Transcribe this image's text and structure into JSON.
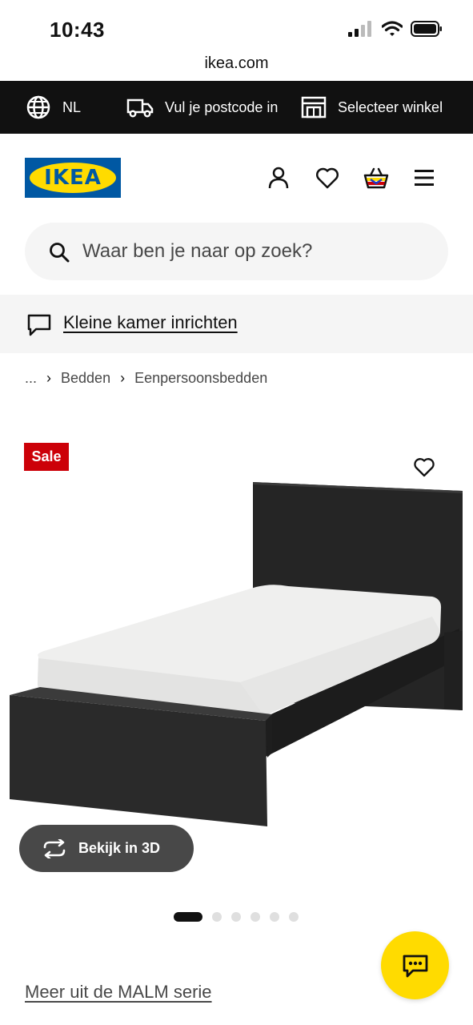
{
  "status_bar": {
    "time": "10:43"
  },
  "browser": {
    "url": "ikea.com"
  },
  "topbar": {
    "language": "NL",
    "postcode": "Vul je postcode in",
    "store": "Selecteer winkel"
  },
  "header": {
    "logo_text": "IKEA"
  },
  "search": {
    "placeholder": "Waar ben je naar op zoek?"
  },
  "banner": {
    "link": "Kleine kamer inrichten"
  },
  "breadcrumb": {
    "ellipsis": "...",
    "items": [
      "Bedden",
      "Eenpersoonsbedden"
    ]
  },
  "product": {
    "badge": "Sale",
    "view_3d_label": "Bekijk in 3D",
    "image_count": 6,
    "active_image": 1,
    "series_link": "Meer uit de MALM serie"
  },
  "colors": {
    "brand_blue": "#0058a3",
    "brand_yellow": "#ffdb00",
    "sale_red": "#cc0008"
  }
}
